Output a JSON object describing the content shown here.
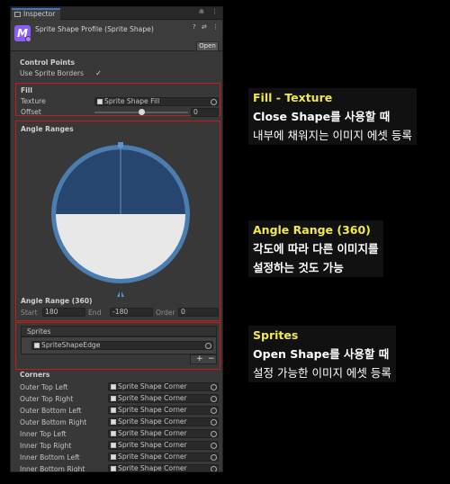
{
  "inspector": {
    "tab_label": "Inspector",
    "tab_icons": "⋒ ⋮",
    "header_title": "Sprite Shape Profile (Sprite Shape)",
    "header_icons": "? ⇄ ⋮",
    "open_label": "Open",
    "logo_letter": "M"
  },
  "control_points": {
    "heading": "Control Points",
    "use_borders_label": "Use Sprite Borders",
    "use_borders_checked": "✓"
  },
  "fill": {
    "heading": "Fill",
    "texture_label": "Texture",
    "texture_value": "Sprite Shape Fill",
    "offset_label": "Offset",
    "offset_value": "0",
    "offset_slider": 0.5
  },
  "angle_ranges": {
    "heading": "Angle Ranges",
    "range_title": "Angle Range (360)",
    "start_label": "Start",
    "start_value": "180",
    "end_label": "End",
    "end_value": "-180",
    "order_label": "Order",
    "order_value": "0"
  },
  "sprites": {
    "heading": "Sprites",
    "item": "SpriteShapeEdge",
    "add_icon": "+",
    "remove_icon": "−"
  },
  "corners": {
    "heading": "Corners",
    "rows": [
      {
        "label": "Outer Top Left",
        "value": "Sprite Shape Corner"
      },
      {
        "label": "Outer Top Right",
        "value": "Sprite Shape Corner"
      },
      {
        "label": "Outer Bottom Left",
        "value": "Sprite Shape Corner"
      },
      {
        "label": "Outer Bottom Right",
        "value": "Sprite Shape Corner"
      },
      {
        "label": "Inner Top Left",
        "value": "Sprite Shape Corner"
      },
      {
        "label": "Inner Top Right",
        "value": "Sprite Shape Corner"
      },
      {
        "label": "Inner Bottom Left",
        "value": "Sprite Shape Corner"
      },
      {
        "label": "Inner Bottom Right",
        "value": "Sprite Shape Corner"
      }
    ]
  },
  "annotations": {
    "fill": {
      "title": "Fill - Texture",
      "line1": "Close Shape를 사용할 때",
      "line2": "내부에 채워지는 이미지 에셋 등록"
    },
    "angle": {
      "title": "Angle Range (360)",
      "line1": "각도에 따라 다른 이미지를",
      "line2": "설정하는 것도 가능"
    },
    "sprites": {
      "title": "Sprites",
      "line1": "Open Shape를 사용할 때",
      "line2": "설정 가능한 이미지 에셋 등록"
    }
  },
  "colors": {
    "highlight_border": "#c41b1b",
    "annotation_title": "#f2e84a",
    "angle_ring": "#4a7db1",
    "angle_fill": "#e8e8e8",
    "angle_selected": "#26466f"
  }
}
